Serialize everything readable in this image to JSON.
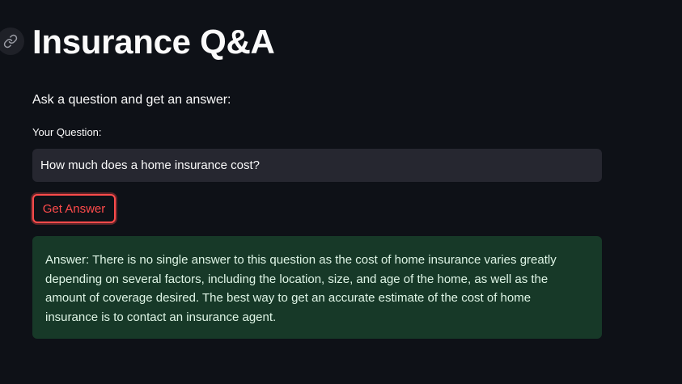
{
  "header": {
    "anchor_icon": "link-icon",
    "title": "Insurance Q&A"
  },
  "main": {
    "intro": "Ask a question and get an answer:",
    "question_label": "Your Question:",
    "question_value": "How much does a home insurance cost?",
    "button_label": "Get Answer",
    "answer": "Answer: There is no single answer to this question as the cost of home insurance varies greatly depending on several factors, including the location, size, and age of the home, as well as the amount of coverage desired. The best way to get an accurate estimate of the cost of home insurance is to contact an insurance agent."
  },
  "colors": {
    "background": "#0e1117",
    "input_background": "#262730",
    "accent": "#ff4b4b",
    "success_background": "#173928",
    "success_text": "#dff5e6"
  }
}
